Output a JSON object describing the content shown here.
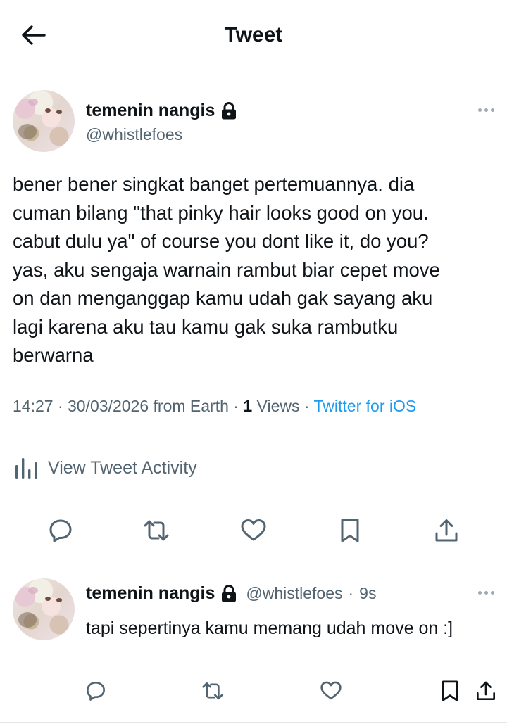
{
  "header": {
    "title": "Tweet",
    "back_icon": "arrow-left-icon"
  },
  "tweet": {
    "display_name": "temenin nangis",
    "handle": "@whistlefoes",
    "text": "bener bener singkat banget pertemuannya. dia\ncuman bilang \"that pinky hair looks good on you.\ncabut dulu ya\" of course you dont like it, do you?\nyas, aku sengaja warnain rambut biar cepet move\non dan menganggap kamu udah gak sayang aku\nlagi karena aku tau kamu gak suka rambutku\nberwarna",
    "time": "14:27",
    "date": "30/03/2026",
    "location": "from Earth",
    "views_count": "1",
    "views_label": "Views",
    "client": "Twitter for iOS",
    "separator": "·"
  },
  "activity": {
    "label": "View Tweet Activity",
    "icon": "bar-chart-icon"
  },
  "actions": [
    "reply-icon",
    "retweet-icon",
    "like-icon",
    "bookmark-icon",
    "share-icon"
  ],
  "reply": {
    "display_name": "temenin nangis",
    "handle": "@whistlefoes",
    "separator": "·",
    "age": "9s",
    "text": "tapi sepertinya kamu memang udah move on :]"
  },
  "colors": {
    "text": "#0f1419",
    "secondary": "#536471",
    "link": "#1d9bf0",
    "divider": "#e4e8eb"
  }
}
